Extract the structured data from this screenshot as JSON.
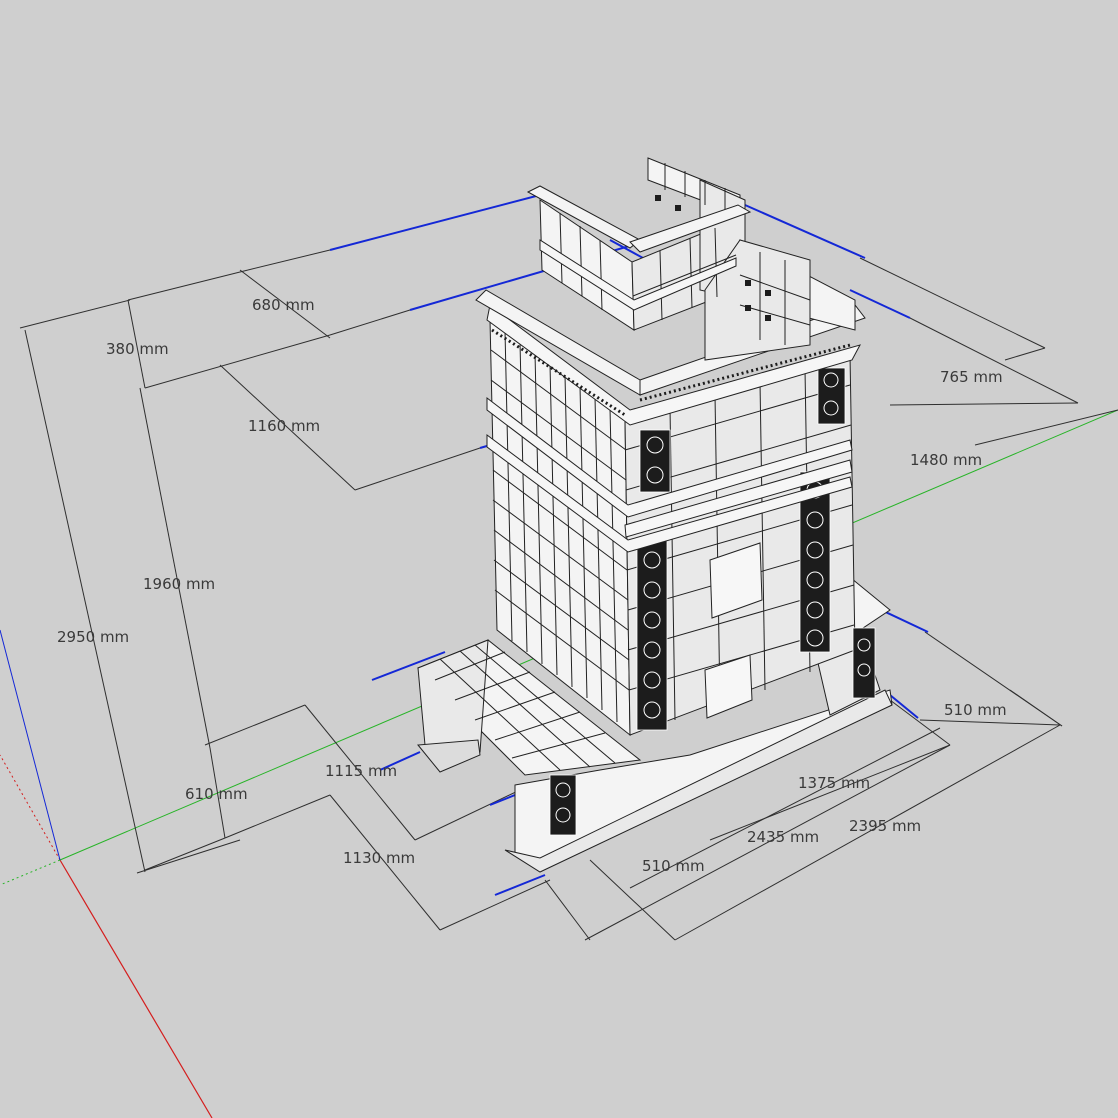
{
  "colors": {
    "background": "#cfcfcf",
    "dimension_line": "#2f2f2f",
    "dimension_highlight": "#1428d6",
    "axis_red": "#d41d1d",
    "axis_green": "#28b428",
    "axis_blue": "#1428d6",
    "model_face": "#f2f2f2",
    "model_edge": "#222222",
    "ornament": "#1c1c1c"
  },
  "dimensions": {
    "d_680": "680 mm",
    "d_380": "380 mm",
    "d_1160": "1160 mm",
    "d_765": "765 mm",
    "d_1480": "1480 mm",
    "d_1960": "1960 mm",
    "d_2950": "2950 mm",
    "d_510_right": "510 mm",
    "d_1375": "1375 mm",
    "d_1115": "1115 mm",
    "d_610": "610 mm",
    "d_2435": "2435 mm",
    "d_2395": "2395 mm",
    "d_1130": "1130 mm",
    "d_510_bottom": "510 mm"
  },
  "model": {
    "name_icon": "tiled-stove-model-icon",
    "axes": [
      "red-axis",
      "green-axis",
      "blue-axis"
    ]
  }
}
